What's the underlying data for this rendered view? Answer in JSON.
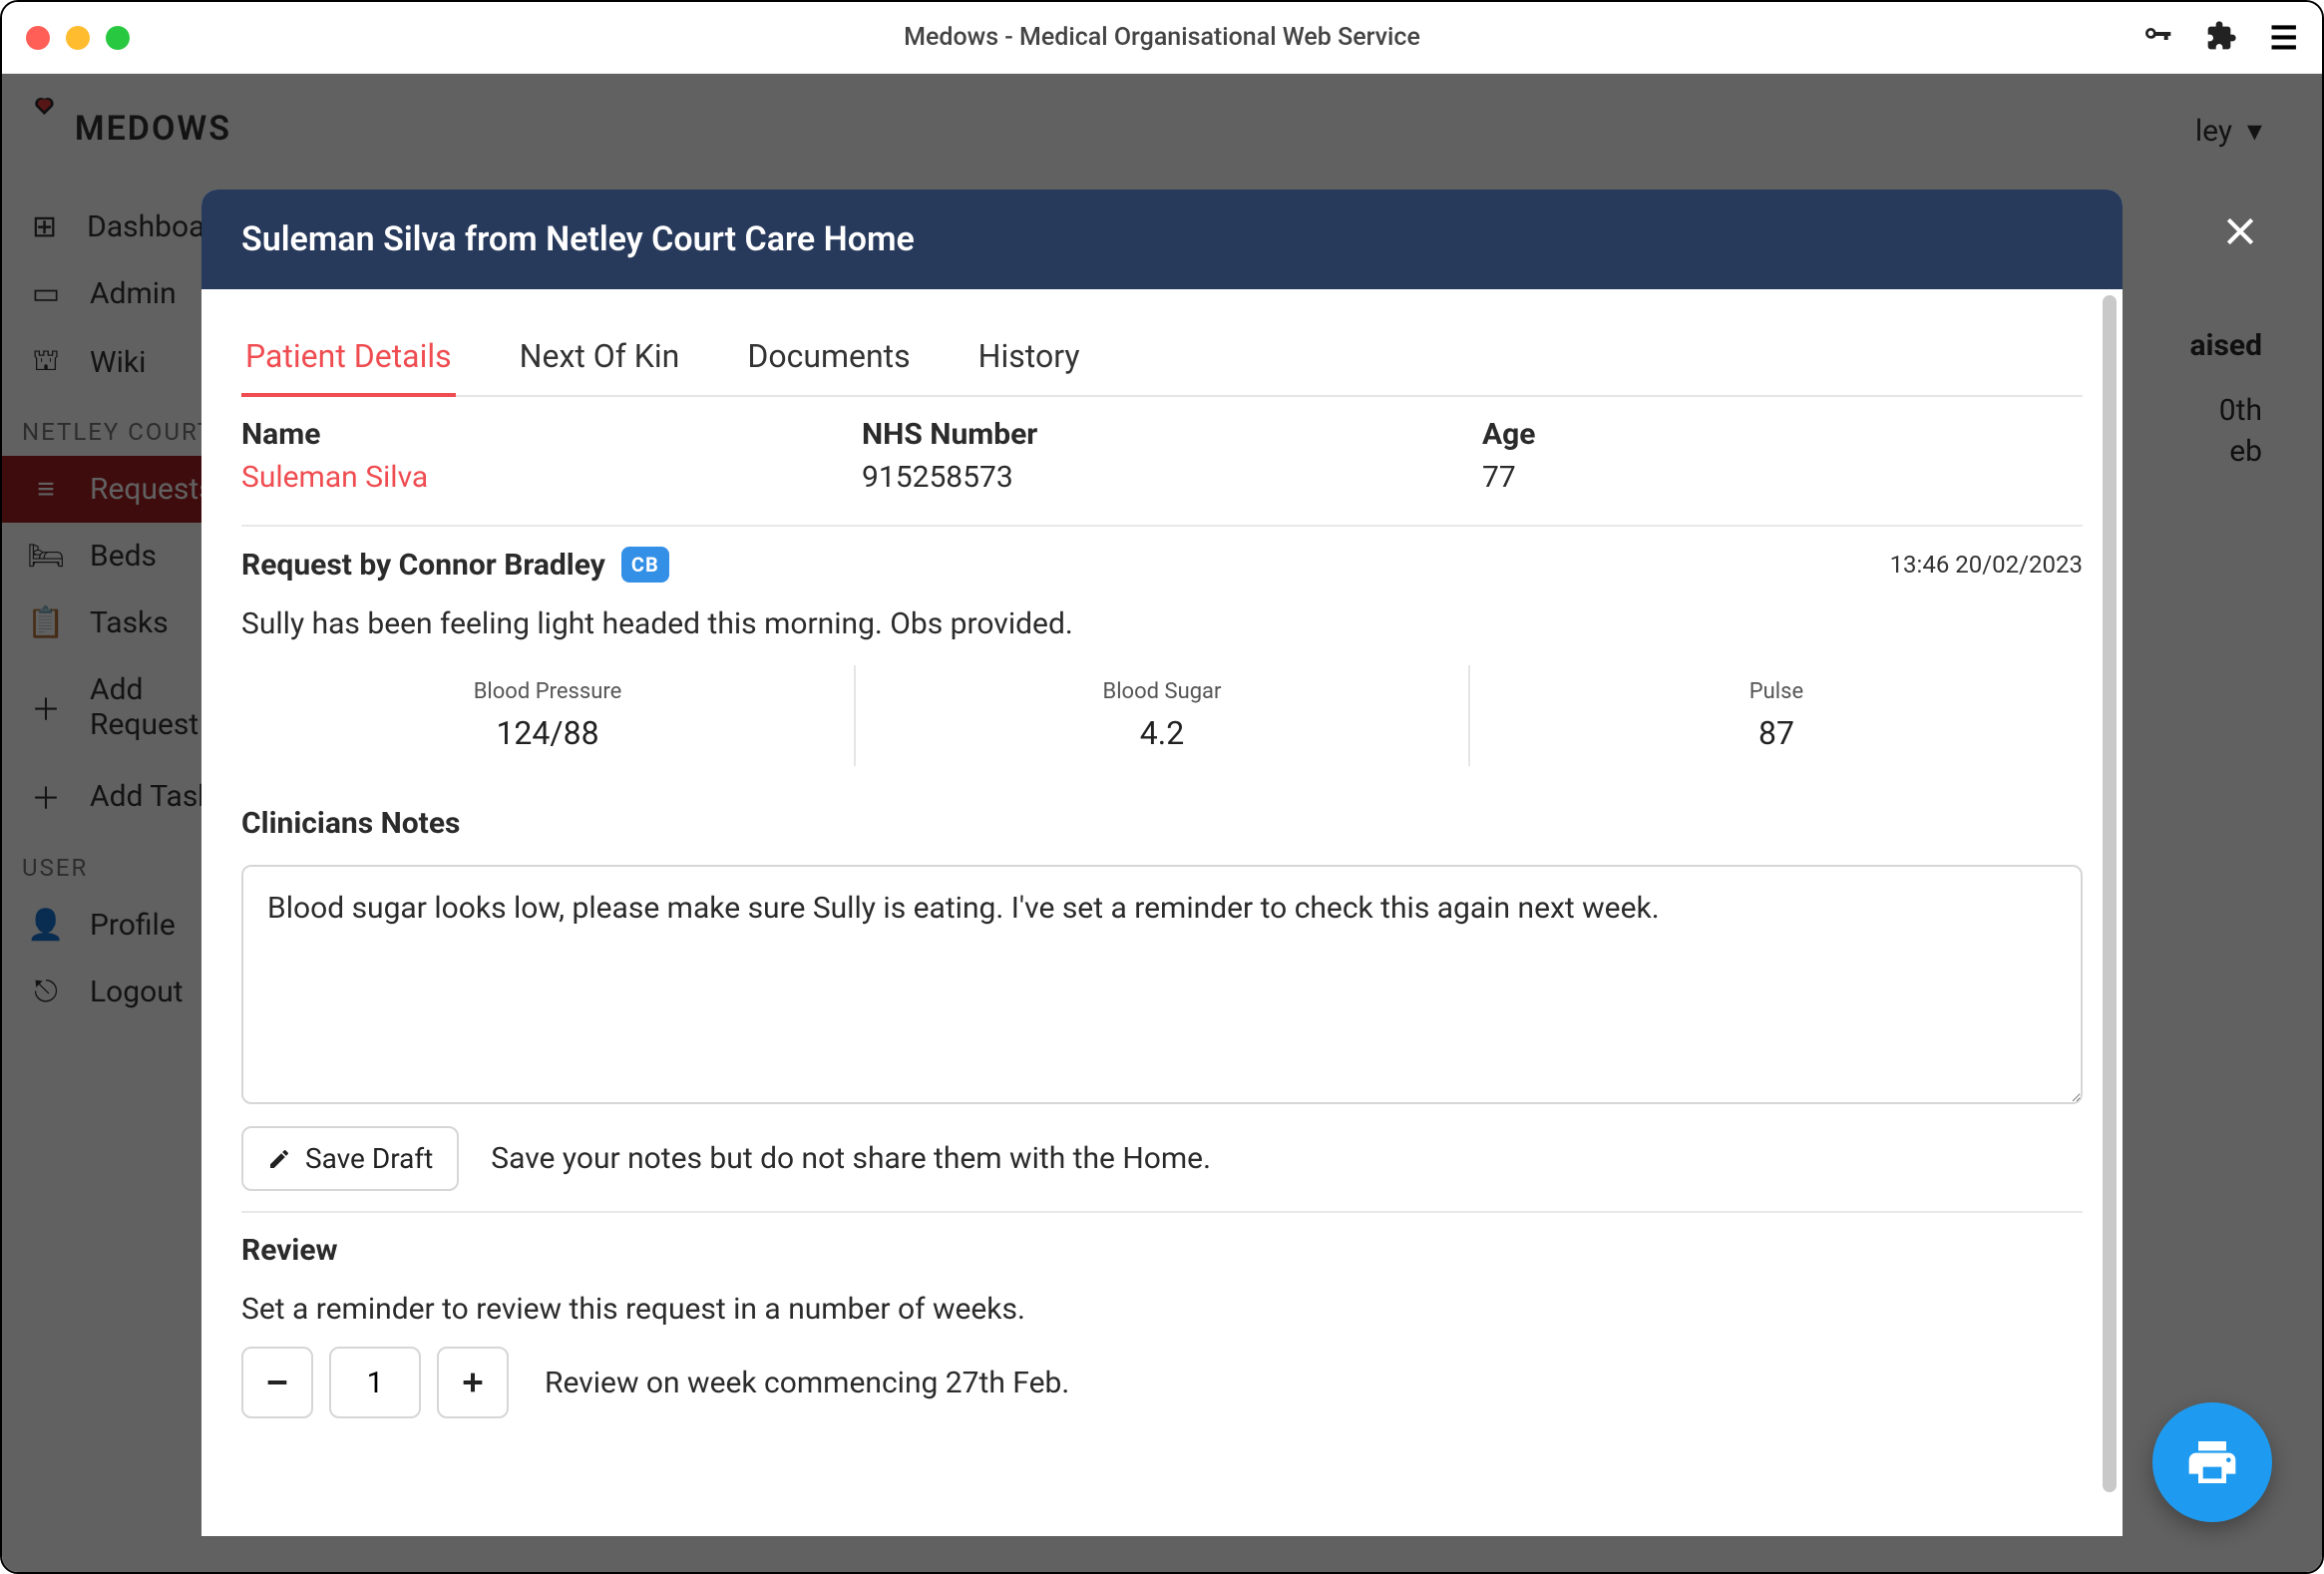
{
  "window": {
    "title": "Medows - Medical Organisational Web Service"
  },
  "brand": "MEDOWS",
  "sidebar": {
    "items": [
      {
        "label": "Dashboard",
        "icon": "dashboard-icon"
      },
      {
        "label": "Admin",
        "icon": "badge-icon"
      },
      {
        "label": "Wiki",
        "icon": "library-icon"
      }
    ],
    "section1_label": "NETLEY COURT",
    "section1_items": [
      {
        "label": "Requests",
        "icon": "list-icon",
        "active": true
      },
      {
        "label": "Beds",
        "icon": "bed-icon"
      },
      {
        "label": "Tasks",
        "icon": "clipboard-icon"
      },
      {
        "label": "Add Request",
        "icon": "plus-icon"
      },
      {
        "label": "Add Task",
        "icon": "plus-icon"
      }
    ],
    "section2_label": "USER",
    "section2_items": [
      {
        "label": "Profile",
        "icon": "user-icon"
      },
      {
        "label": "Logout",
        "icon": "logout-icon"
      }
    ]
  },
  "background": {
    "user_dropdown": "ley",
    "raised_label": "aised",
    "raised_lines": [
      "0th",
      "eb"
    ]
  },
  "modal": {
    "title": "Suleman Silva from Netley Court Care Home",
    "tabs": [
      "Patient Details",
      "Next Of Kin",
      "Documents",
      "History"
    ],
    "active_tab": "Patient Details",
    "patient": {
      "name_label": "Name",
      "name_value": "Suleman Silva",
      "nhs_label": "NHS Number",
      "nhs_value": "915258573",
      "age_label": "Age",
      "age_value": "77"
    },
    "request": {
      "title": "Request by Connor Bradley",
      "initials": "CB",
      "timestamp": "13:46 20/02/2023",
      "text": "Sully has been feeling light headed this morning. Obs provided.",
      "obs": [
        {
          "label": "Blood Pressure",
          "value": "124/88"
        },
        {
          "label": "Blood Sugar",
          "value": "4.2"
        },
        {
          "label": "Pulse",
          "value": "87"
        }
      ]
    },
    "clinicians": {
      "title": "Clinicians Notes",
      "value": "Blood sugar looks low, please make sure Sully is eating. I've set a reminder to check this again next week.",
      "save_label": "Save Draft",
      "save_hint": "Save your notes but do not share them with the Home."
    },
    "review": {
      "title": "Review",
      "description": "Set a reminder to review this request in a number of weeks.",
      "weeks": "1",
      "summary": "Review on week commencing 27th Feb."
    }
  }
}
